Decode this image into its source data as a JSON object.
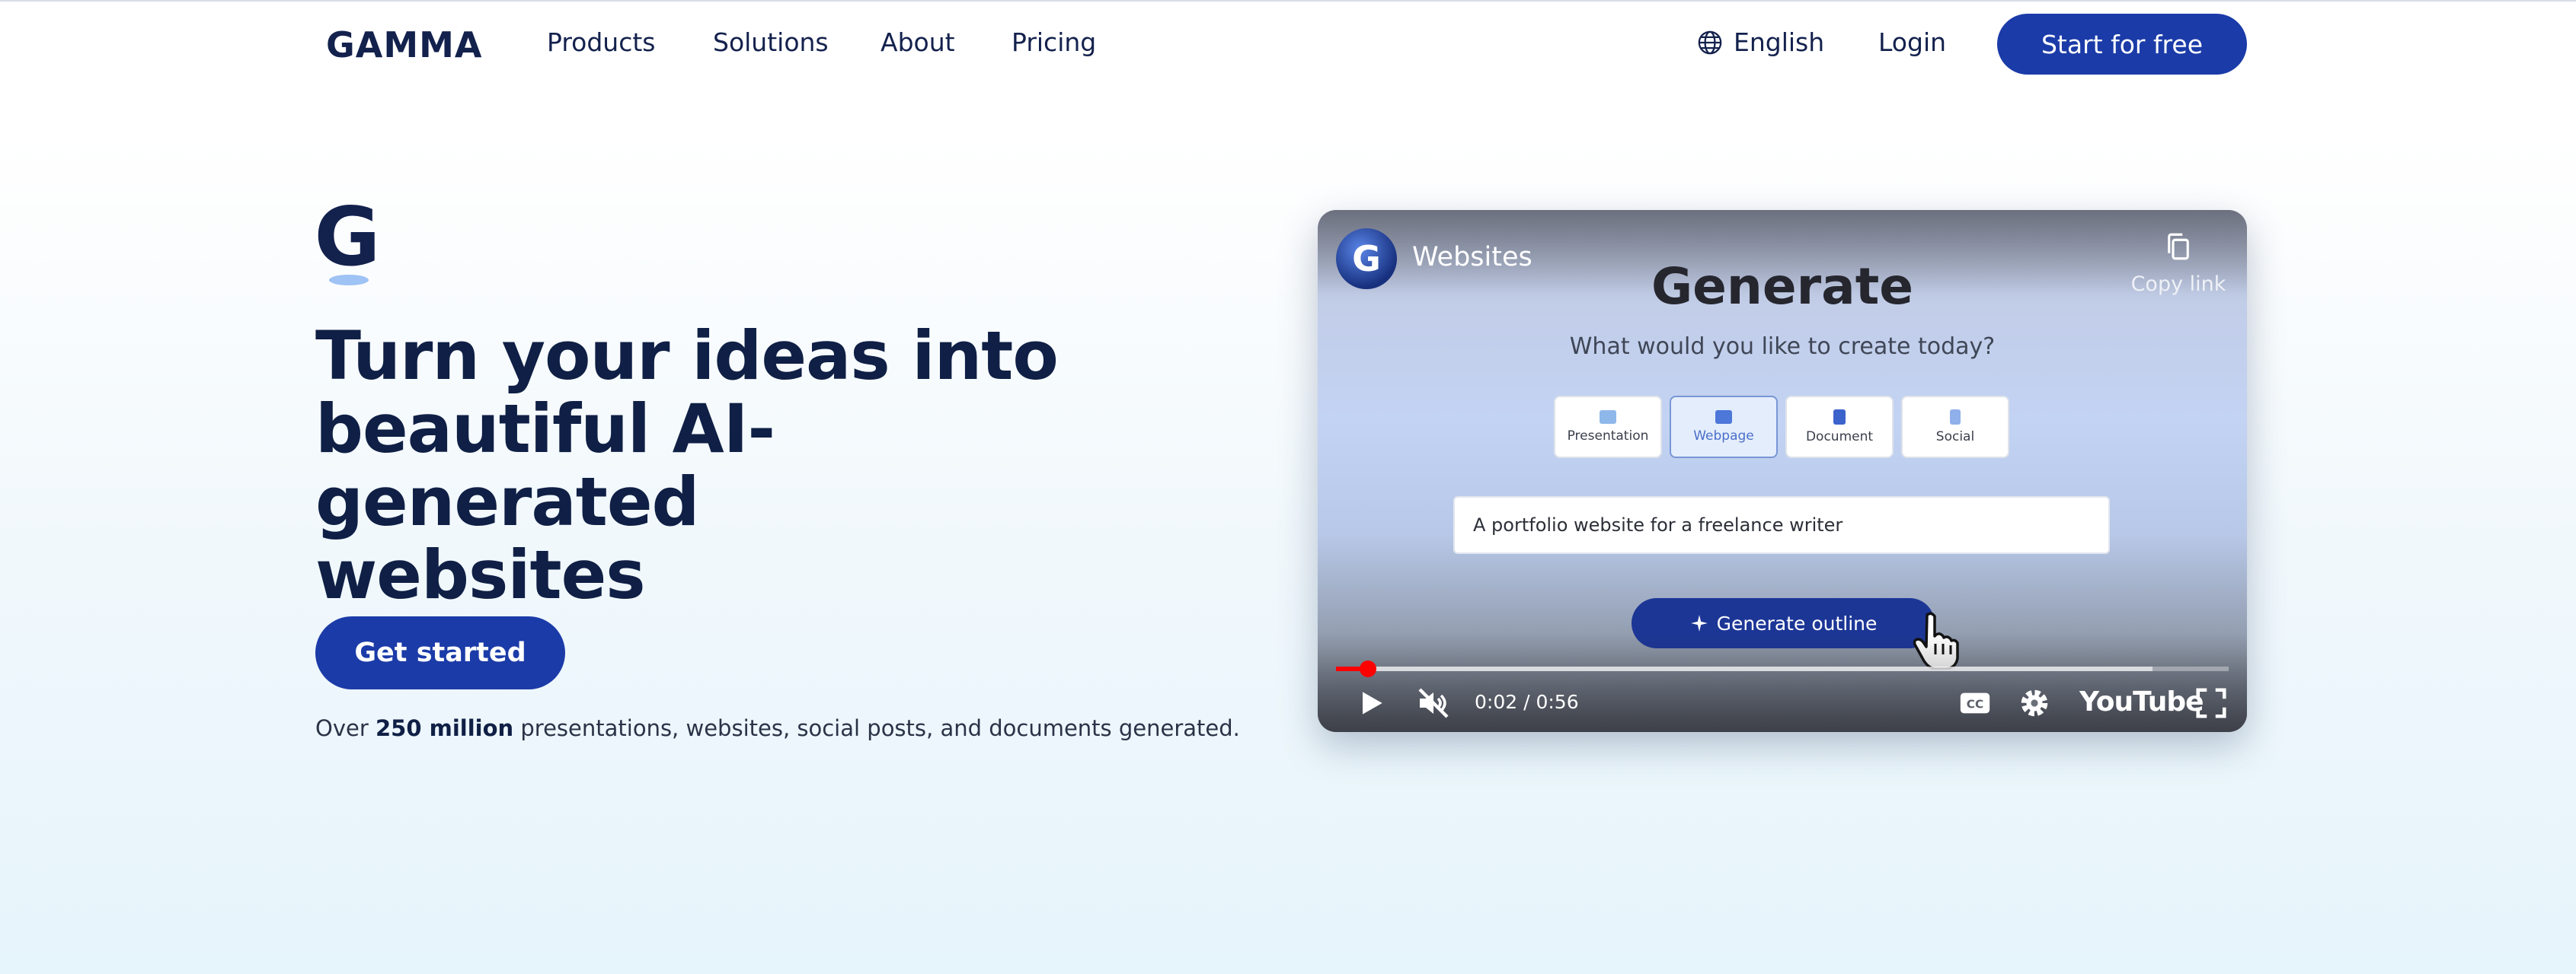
{
  "nav": {
    "logo": "GAMMA",
    "links": [
      "Products",
      "Solutions",
      "About",
      "Pricing"
    ],
    "language": "English",
    "login": "Login",
    "cta": "Start for free"
  },
  "hero": {
    "mark_letter": "G",
    "title_lines": [
      "Turn your ideas into",
      "beautiful AI-generated",
      "websites"
    ],
    "cta": "Get started",
    "stats_prefix": "Over ",
    "stats_bold": "250 million",
    "stats_suffix": " presentations, websites, social posts, and documents generated."
  },
  "video": {
    "channel_initial": "G",
    "title": "Websites",
    "copy_link": "Copy link",
    "heading": "Generate",
    "subheading": "What would you like to create today?",
    "options": [
      {
        "label": "Presentation",
        "icon": "presentation-icon",
        "color": "#8fb8ea",
        "selected": false
      },
      {
        "label": "Webpage",
        "icon": "webpage-icon",
        "color": "#4d77d9",
        "selected": true
      },
      {
        "label": "Document",
        "icon": "document-icon",
        "color": "#3c63cc",
        "selected": false
      },
      {
        "label": "Social",
        "icon": "social-icon",
        "color": "#8fb0ea",
        "selected": false
      }
    ],
    "prompt_value": "A portfolio website for a freelance writer",
    "generate_button": "Generate outline",
    "time": "0:02 / 0:56",
    "progress_fraction": 0.036,
    "buffer_fraction": 0.915,
    "youtube": "YouTube"
  },
  "colors": {
    "primary": "#1b3ba8",
    "text": "#0f1f45",
    "progress": "#ff0000"
  }
}
